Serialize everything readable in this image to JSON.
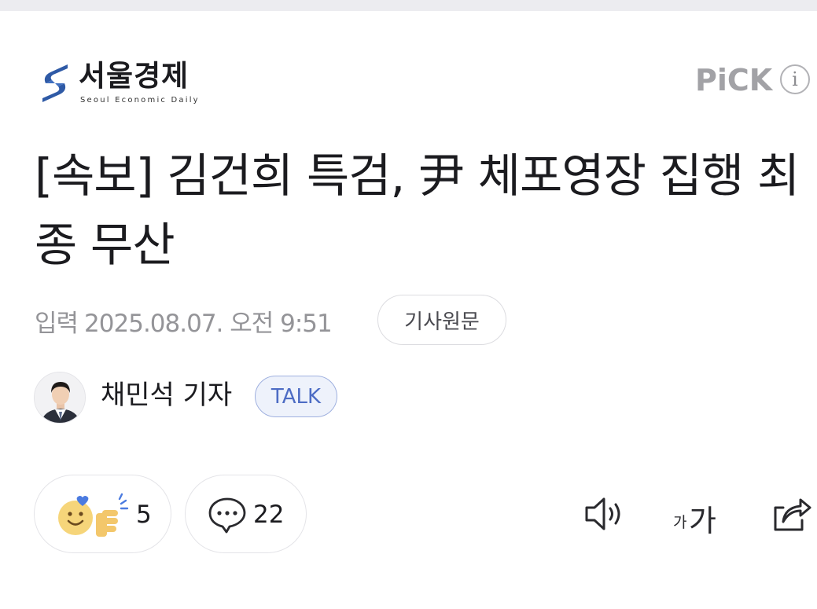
{
  "press": {
    "name": "서울경제",
    "subtitle": "Seoul Economic Daily"
  },
  "pick": {
    "label": "PiCK",
    "info_glyph": "i"
  },
  "article": {
    "headline": "[속보] 김건희 특검, 尹 체포영장 집행 최종 무산",
    "date_label": "입력",
    "date_value": "2025.08.07. 오전 9:51",
    "original_button": "기사원문"
  },
  "reporter": {
    "name": "채민석 기자",
    "talk_button": "TALK"
  },
  "reactions": {
    "count": "5",
    "icon": "smiley-thumbs-up-icon"
  },
  "comments": {
    "count": "22",
    "icon": "speech-bubble-icon"
  },
  "tools": {
    "audio_icon": "speaker-icon",
    "font_small": "가",
    "font_large": "가",
    "share_icon": "share-icon"
  },
  "colors": {
    "headline": "#1b1b1f",
    "meta_gray": "#949498",
    "talk_accent": "#4d6cc4",
    "logo_blue": "#2f5aa6"
  }
}
